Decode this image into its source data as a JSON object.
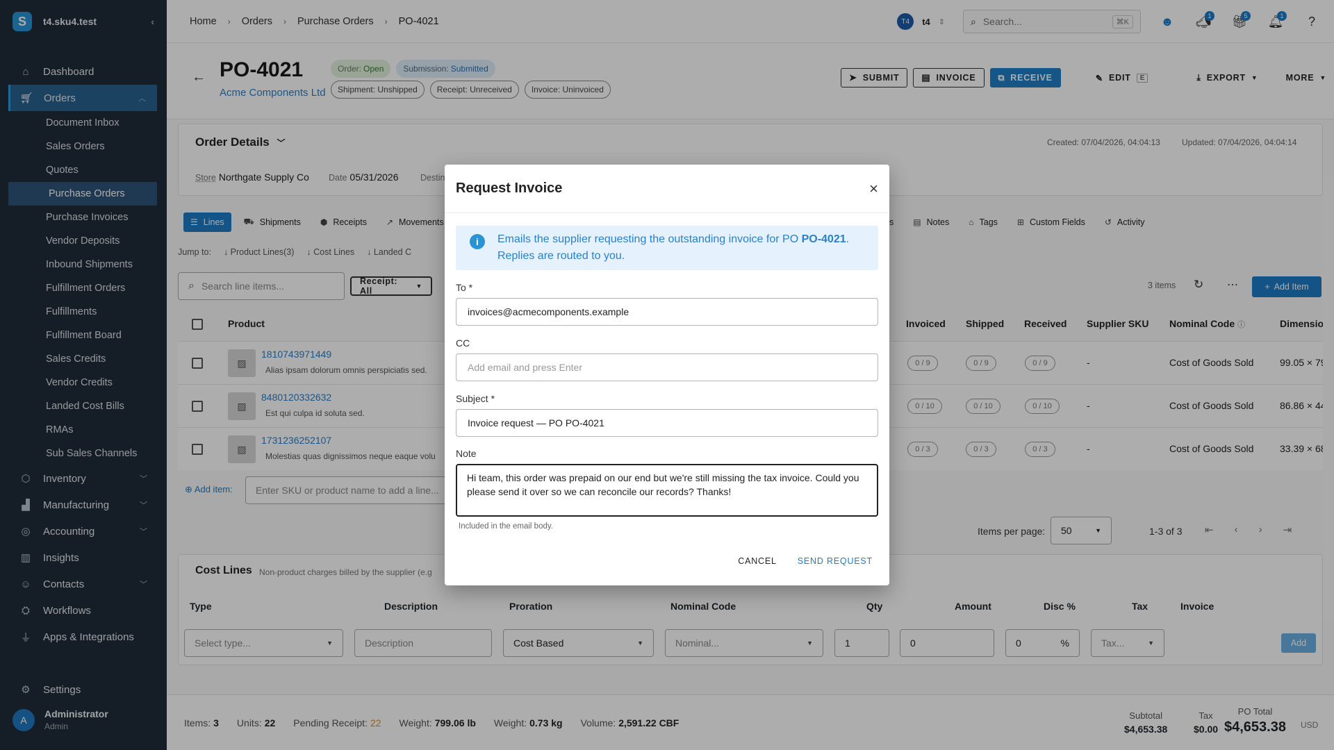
{
  "workspace": {
    "name": "t4.sku4.test",
    "logo_letter": "S"
  },
  "nav": {
    "dashboard": "Dashboard",
    "orders": "Orders",
    "orders_sub": [
      "Document Inbox",
      "Sales Orders",
      "Quotes",
      "Purchase Orders",
      "Purchase Invoices",
      "Vendor Deposits",
      "Inbound Shipments",
      "Fulfillment Orders",
      "Fulfillments",
      "Fulfillment Board",
      "Sales Credits",
      "Vendor Credits",
      "Landed Cost Bills",
      "RMAs",
      "Sub Sales Channels"
    ],
    "inventory": "Inventory",
    "manufacturing": "Manufacturing",
    "accounting": "Accounting",
    "insights": "Insights",
    "contacts": "Contacts",
    "workflows": "Workflows",
    "apps": "Apps & Integrations",
    "settings": "Settings"
  },
  "user": {
    "initial": "A",
    "name": "Administrator",
    "role": "Admin"
  },
  "breadcrumb": [
    "Home",
    "Orders",
    "Purchase Orders",
    "PO-4021"
  ],
  "topbar": {
    "org_badge": "T4",
    "org_name": "t4",
    "search_placeholder": "Search...",
    "search_kbd": "⌘K",
    "badges": [
      "1",
      "5",
      "1"
    ]
  },
  "po": {
    "number": "PO-4021",
    "vendor": "Acme Components Ltd",
    "chips_top": [
      {
        "k": "Order:",
        "v": "Open"
      },
      {
        "k": "Submission:",
        "v": "Submitted"
      }
    ],
    "chips_bottom": [
      "Shipment: Unshipped",
      "Receipt: Unreceived",
      "Invoice: Uninvoiced"
    ]
  },
  "actions": {
    "submit": "SUBMIT",
    "invoice": "INVOICE",
    "receive": "RECEIVE",
    "edit": "EDIT",
    "edit_kbd": "E",
    "export": "EXPORT",
    "more": "MORE"
  },
  "order_details": {
    "title": "Order Details",
    "created": "Created: 07/04/2026, 04:04:13",
    "updated": "Updated: 07/04/2026, 04:04:14",
    "store_label": "Store",
    "store": "Northgate Supply Co",
    "date_label": "Date",
    "date": "05/31/2026",
    "dest_label": "Destin"
  },
  "tabs": [
    "Lines",
    "Shipments",
    "Receipts",
    "Movements",
    "s",
    "Notes",
    "Tags",
    "Custom Fields",
    "Activity"
  ],
  "jump": {
    "label": "Jump to:",
    "items": [
      "Product Lines(3)",
      "Cost Lines",
      "Landed C"
    ]
  },
  "lines": {
    "search_placeholder": "Search line items...",
    "receipt_filter": "Receipt: All",
    "count": "3 items",
    "add_item": "Add Item",
    "headers": {
      "product": "Product",
      "invoiced": "Invoiced",
      "shipped": "Shipped",
      "received": "Received",
      "supplier_sku": "Supplier SKU",
      "nominal": "Nominal Code",
      "dimension": "Dimensior"
    },
    "rows": [
      {
        "sku": "1810743971449",
        "desc": "Alias ipsam dolorum omnis perspiciatis sed.",
        "invoiced": "0 / 9",
        "shipped": "0 / 9",
        "received": "0 / 9",
        "supplier_sku": "-",
        "nominal": "Cost of Goods Sold",
        "dim": "99.05 × 79"
      },
      {
        "sku": "8480120332632",
        "desc": "Est qui culpa id soluta sed.",
        "invoiced": "0 / 10",
        "shipped": "0 / 10",
        "received": "0 / 10",
        "supplier_sku": "-",
        "nominal": "Cost of Goods Sold",
        "dim": "86.86 × 44"
      },
      {
        "sku": "1731236252107",
        "desc": "Molestias quas dignissimos neque eaque volu",
        "invoiced": "0 / 3",
        "shipped": "0 / 3",
        "received": "0 / 3",
        "supplier_sku": "-",
        "nominal": "Cost of Goods Sold",
        "dim": "33.39 × 68"
      }
    ],
    "add_item_label": "Add item:",
    "add_item_placeholder": "Enter SKU or product name to add a line...",
    "per_page_label": "Items per page:",
    "per_page": "50",
    "range": "1-3 of 3"
  },
  "cost_lines": {
    "title": "Cost Lines",
    "subtitle": "Non-product charges billed by the supplier (e.g",
    "headers": [
      "Type",
      "Description",
      "Proration",
      "Nominal Code",
      "Qty",
      "Amount",
      "Disc %",
      "Tax",
      "Invoice"
    ],
    "type_placeholder": "Select type...",
    "desc_placeholder": "Description",
    "proration": "Cost Based",
    "nominal_placeholder": "Nominal...",
    "qty": "1",
    "amount": "0",
    "disc": "0",
    "disc_unit": "%",
    "tax_placeholder": "Tax...",
    "add": "Add"
  },
  "footer": {
    "items_label": "Items:",
    "items": "3",
    "units_label": "Units:",
    "units": "22",
    "pending_label": "Pending Receipt:",
    "pending": "22",
    "weight_label": "Weight:",
    "weight_lb": "799.06 lb",
    "weight_kg": "0.73 kg",
    "volume_label": "Volume:",
    "volume": "2,591.22 CBF",
    "subtotal_label": "Subtotal",
    "subtotal": "$4,653.38",
    "tax_label": "Tax",
    "tax": "$0.00",
    "total_label": "PO Total",
    "total": "$4,653.38",
    "currency": "USD"
  },
  "modal": {
    "title": "Request Invoice",
    "info_pre": "Emails the supplier requesting the outstanding invoice for PO ",
    "info_po": "PO-4021",
    "info_post": ". Replies are routed to you.",
    "to_label": "To *",
    "to_value": "invoices@acmecomponents.example",
    "cc_label": "CC",
    "cc_placeholder": "Add email and press Enter",
    "subject_label": "Subject *",
    "subject_value": "Invoice request — PO PO-4021",
    "note_label": "Note",
    "note_value": "Hi team, this order was prepaid on our end but we're still missing the tax invoice. Could you please send it over so we can reconcile our records? Thanks!",
    "note_help": "Included in the email body.",
    "cancel": "CANCEL",
    "send": "SEND REQUEST"
  }
}
